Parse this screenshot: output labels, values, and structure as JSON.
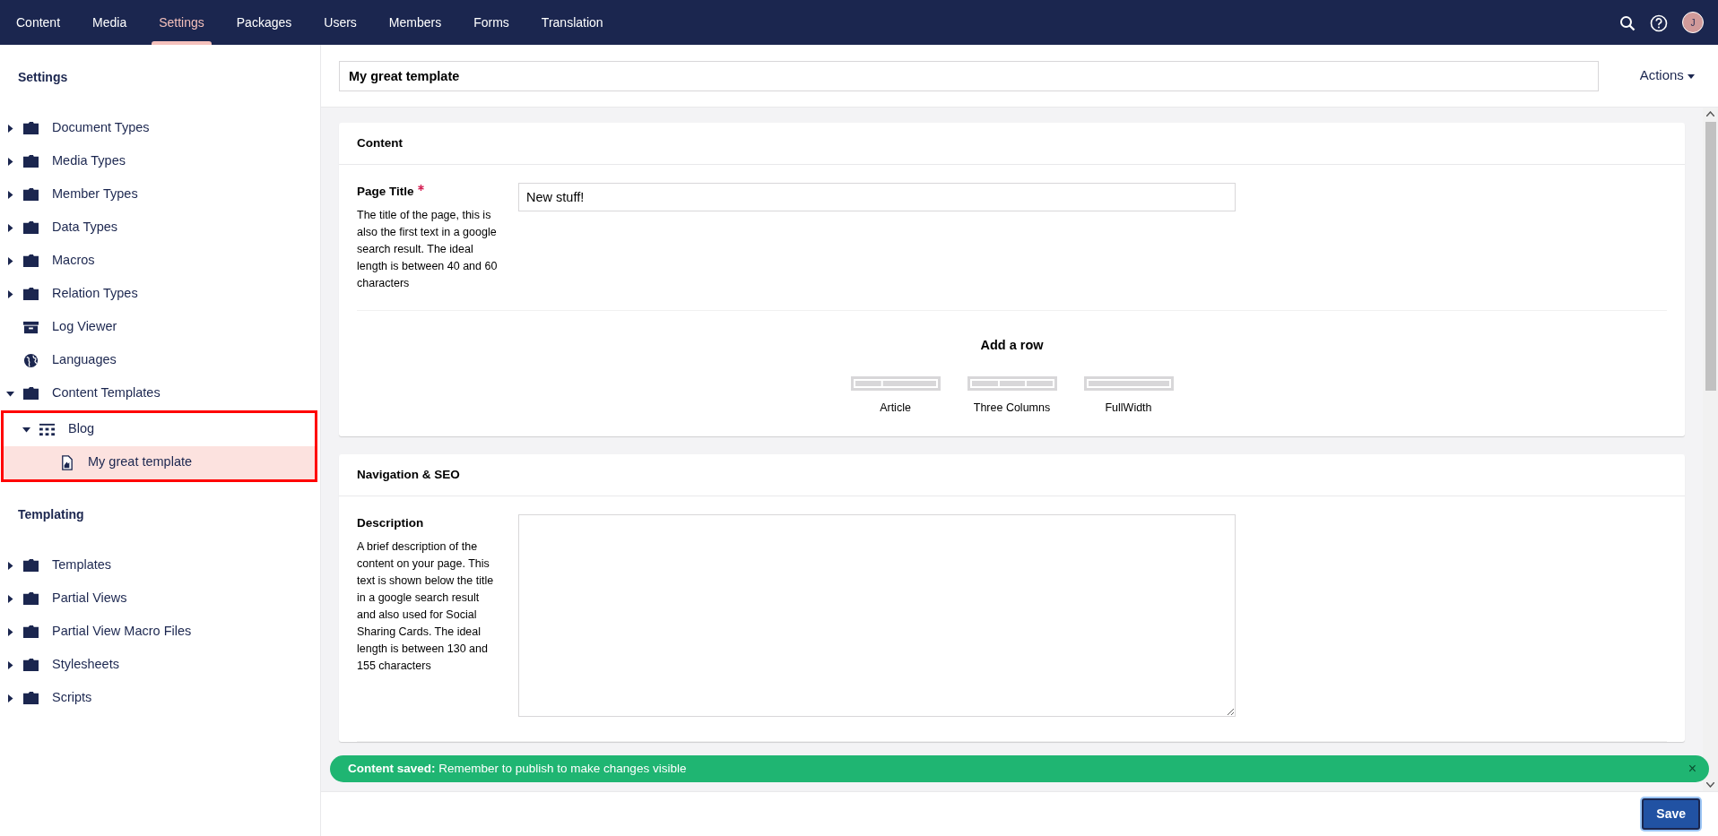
{
  "top_nav": {
    "sections": [
      {
        "label": "Content",
        "selected": false
      },
      {
        "label": "Media",
        "selected": false
      },
      {
        "label": "Settings",
        "selected": true
      },
      {
        "label": "Packages",
        "selected": false
      },
      {
        "label": "Users",
        "selected": false
      },
      {
        "label": "Members",
        "selected": false
      },
      {
        "label": "Forms",
        "selected": false
      },
      {
        "label": "Translation",
        "selected": false
      }
    ],
    "avatar_initial": "J"
  },
  "sidebar": {
    "groups": [
      {
        "title": "Settings",
        "items": [
          {
            "kind": "folder",
            "label": "Document Types",
            "expanded": false,
            "selected": false
          },
          {
            "kind": "folder",
            "label": "Media Types",
            "expanded": false,
            "selected": false
          },
          {
            "kind": "folder",
            "label": "Member Types",
            "expanded": false,
            "selected": false
          },
          {
            "kind": "folder",
            "label": "Data Types",
            "expanded": false,
            "selected": false
          },
          {
            "kind": "folder",
            "label": "Macros",
            "expanded": false,
            "selected": false
          },
          {
            "kind": "folder",
            "label": "Relation Types",
            "expanded": false,
            "selected": false
          },
          {
            "kind": "archive",
            "label": "Log Viewer",
            "selected": false
          },
          {
            "kind": "globe",
            "label": "Languages",
            "selected": false
          },
          {
            "kind": "folder",
            "label": "Content Templates",
            "expanded": true,
            "selected": false,
            "children": [
              {
                "kind": "blueprint",
                "label": "Blog",
                "expanded": true,
                "selected": false,
                "highlighted": true,
                "children": [
                  {
                    "kind": "document",
                    "label": "My great template",
                    "selected": true
                  }
                ]
              }
            ]
          }
        ]
      },
      {
        "title": "Templating",
        "items": [
          {
            "kind": "folder",
            "label": "Templates",
            "expanded": false,
            "selected": false
          },
          {
            "kind": "folder",
            "label": "Partial Views",
            "expanded": false,
            "selected": false
          },
          {
            "kind": "folder",
            "label": "Partial View Macro Files",
            "expanded": false,
            "selected": false
          },
          {
            "kind": "folder",
            "label": "Stylesheets",
            "expanded": false,
            "selected": false
          },
          {
            "kind": "folder",
            "label": "Scripts",
            "expanded": false,
            "selected": false
          }
        ]
      }
    ]
  },
  "editor": {
    "name": "My great template",
    "actions_label": "Actions",
    "groups": [
      {
        "title": "Content",
        "properties": [
          {
            "kind": "textbox",
            "label": "Page Title",
            "required": true,
            "description": "The title of the page, this is also the first text in a google search result. The ideal length is between 40 and 60 characters",
            "value": "New stuff!"
          },
          {
            "kind": "grid",
            "heading": "Add a row",
            "layouts": [
              {
                "kind": "article",
                "label": "Article"
              },
              {
                "kind": "three-columns",
                "label": "Three Columns"
              },
              {
                "kind": "full-width",
                "label": "FullWidth"
              }
            ]
          }
        ]
      },
      {
        "title": "Navigation & SEO",
        "properties": [
          {
            "kind": "textarea",
            "label": "Description",
            "required": false,
            "description": "A brief description of the content on your page. This text is shown below the title in a google search result and also used for Social Sharing Cards. The ideal length is between 130 and 155 characters"
          }
        ]
      }
    ],
    "notification": {
      "message": "**Content saved:** Remember to publish to make changes visible",
      "close": "×"
    },
    "save_label": "Save"
  }
}
